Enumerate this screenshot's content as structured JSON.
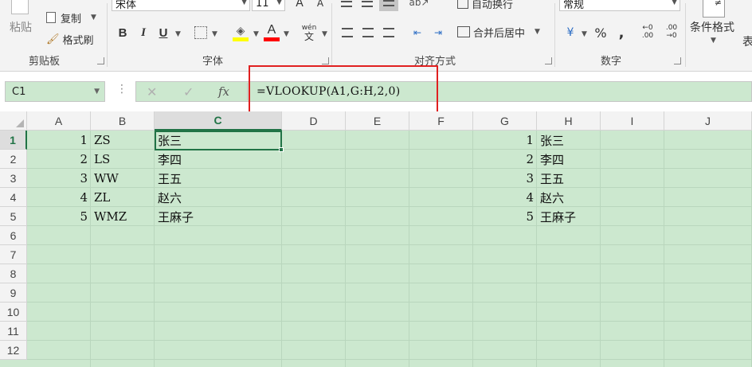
{
  "ribbon": {
    "clipboard": {
      "paste_label": "粘贴",
      "copy_label": "复制",
      "format_painter_label": "格式刷",
      "group_label": "剪贴板"
    },
    "font": {
      "font_name": "宋体",
      "font_size": "11",
      "bold": "B",
      "italic": "I",
      "underline": "U",
      "grow_font": "A",
      "shrink_font": "A",
      "font_color_letter": "A",
      "phonetic_top": "wén",
      "phonetic_bottom": "文",
      "group_label": "字体"
    },
    "alignment": {
      "wrap_text_label": "自动换行",
      "merge_center_label": "合并后居中",
      "group_label": "对齐方式"
    },
    "number": {
      "format_value": "常规",
      "percent": "%",
      "comma": ",",
      "increase_decimal_top": "←0",
      "increase_decimal_bottom": ".00",
      "decrease_decimal_top": ".00",
      "decrease_decimal_bottom": "→0",
      "group_label": "数字"
    },
    "styles": {
      "conditional_format_label": "条件格式",
      "table_format_label_partial": "表"
    },
    "colors": {
      "font_color_bar": "#ff0000",
      "highlight_bar": "#ffff00"
    }
  },
  "formula_bar": {
    "name_box": "C1",
    "cancel_symbol": "✕",
    "enter_symbol": "✓",
    "fx_label": "fx",
    "formula": "=VLOOKUP(A1,G:H,2,0)"
  },
  "grid": {
    "columns": [
      "A",
      "B",
      "C",
      "D",
      "E",
      "F",
      "G",
      "H",
      "I",
      "J"
    ],
    "rows": [
      "1",
      "2",
      "3",
      "4",
      "5",
      "6",
      "7",
      "8",
      "9",
      "10",
      "11",
      "12"
    ],
    "selected_column": "C",
    "selected_row": "1",
    "colA": [
      "1",
      "2",
      "3",
      "4",
      "5"
    ],
    "colB": [
      "ZS",
      "LS",
      "WW",
      "ZL",
      "WMZ"
    ],
    "colC": [
      "张三",
      "李四",
      "王五",
      "赵六",
      "王麻子"
    ],
    "colG": [
      "1",
      "2",
      "3",
      "4",
      "5"
    ],
    "colH": [
      "张三",
      "李四",
      "王五",
      "赵六",
      "王麻子"
    ]
  },
  "theme": {
    "cell_background": "#cce8cf",
    "accent": "#217346",
    "highlight_box": "#e02020"
  }
}
